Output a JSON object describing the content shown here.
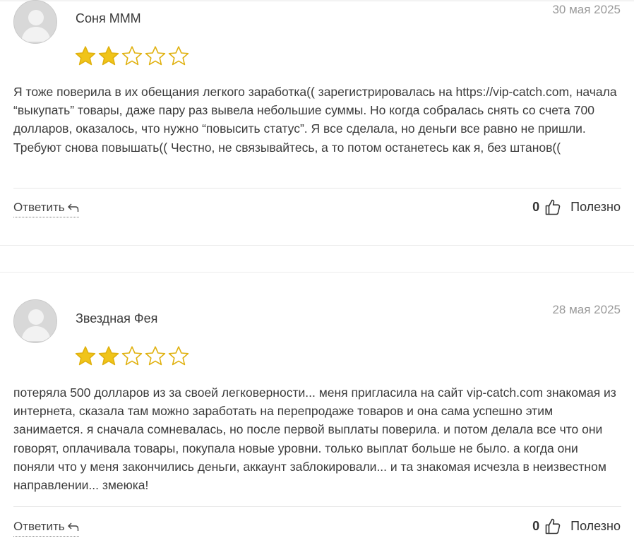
{
  "colors": {
    "star_fill": "#f0c419",
    "star_stroke": "#e0b10f",
    "avatar_bg": "#d8d8d8",
    "date": "#9a9a9a"
  },
  "reviews": [
    {
      "author": "Соня МММ",
      "date": "30 мая 2025",
      "rating": 2,
      "max_rating": 5,
      "text": "Я тоже поверила в их обещания легкого заработка(( зарегистрировалась на https://vip-catch.com, начала “выкупать” товары, даже пару раз вывела небольшие суммы. Но когда собралась снять со счета 700 долларов, оказалось, что нужно “повысить статус”. Я все сделала, но деньги все равно не пришли. Требуют снова повышать(( Честно, не связывайтесь, а то потом останетесь как я, без штанов((",
      "reply_label": "Ответить",
      "helpful_count": "0",
      "helpful_label": "Полезно"
    },
    {
      "author": "Звездная Фея",
      "date": "28 мая 2025",
      "rating": 2,
      "max_rating": 5,
      "text": "потеряла 500 долларов из за своей легковерности... меня пригласила на сайт vip-catch.com знакомая из интернета, сказала там можно заработать на перепродаже товаров и она сама успешно этим занимается. я сначала сомневалась, но после первой выплаты поверила. и потом делала все что они говорят, оплачивала товары, покупала новые уровни. только выплат больше не было. а когда они поняли что у меня закончились деньги, аккаунт заблокировали... и та знакомая исчезла в неизвестном направлении... змеюка!",
      "reply_label": "Ответить",
      "helpful_count": "0",
      "helpful_label": "Полезно"
    }
  ]
}
